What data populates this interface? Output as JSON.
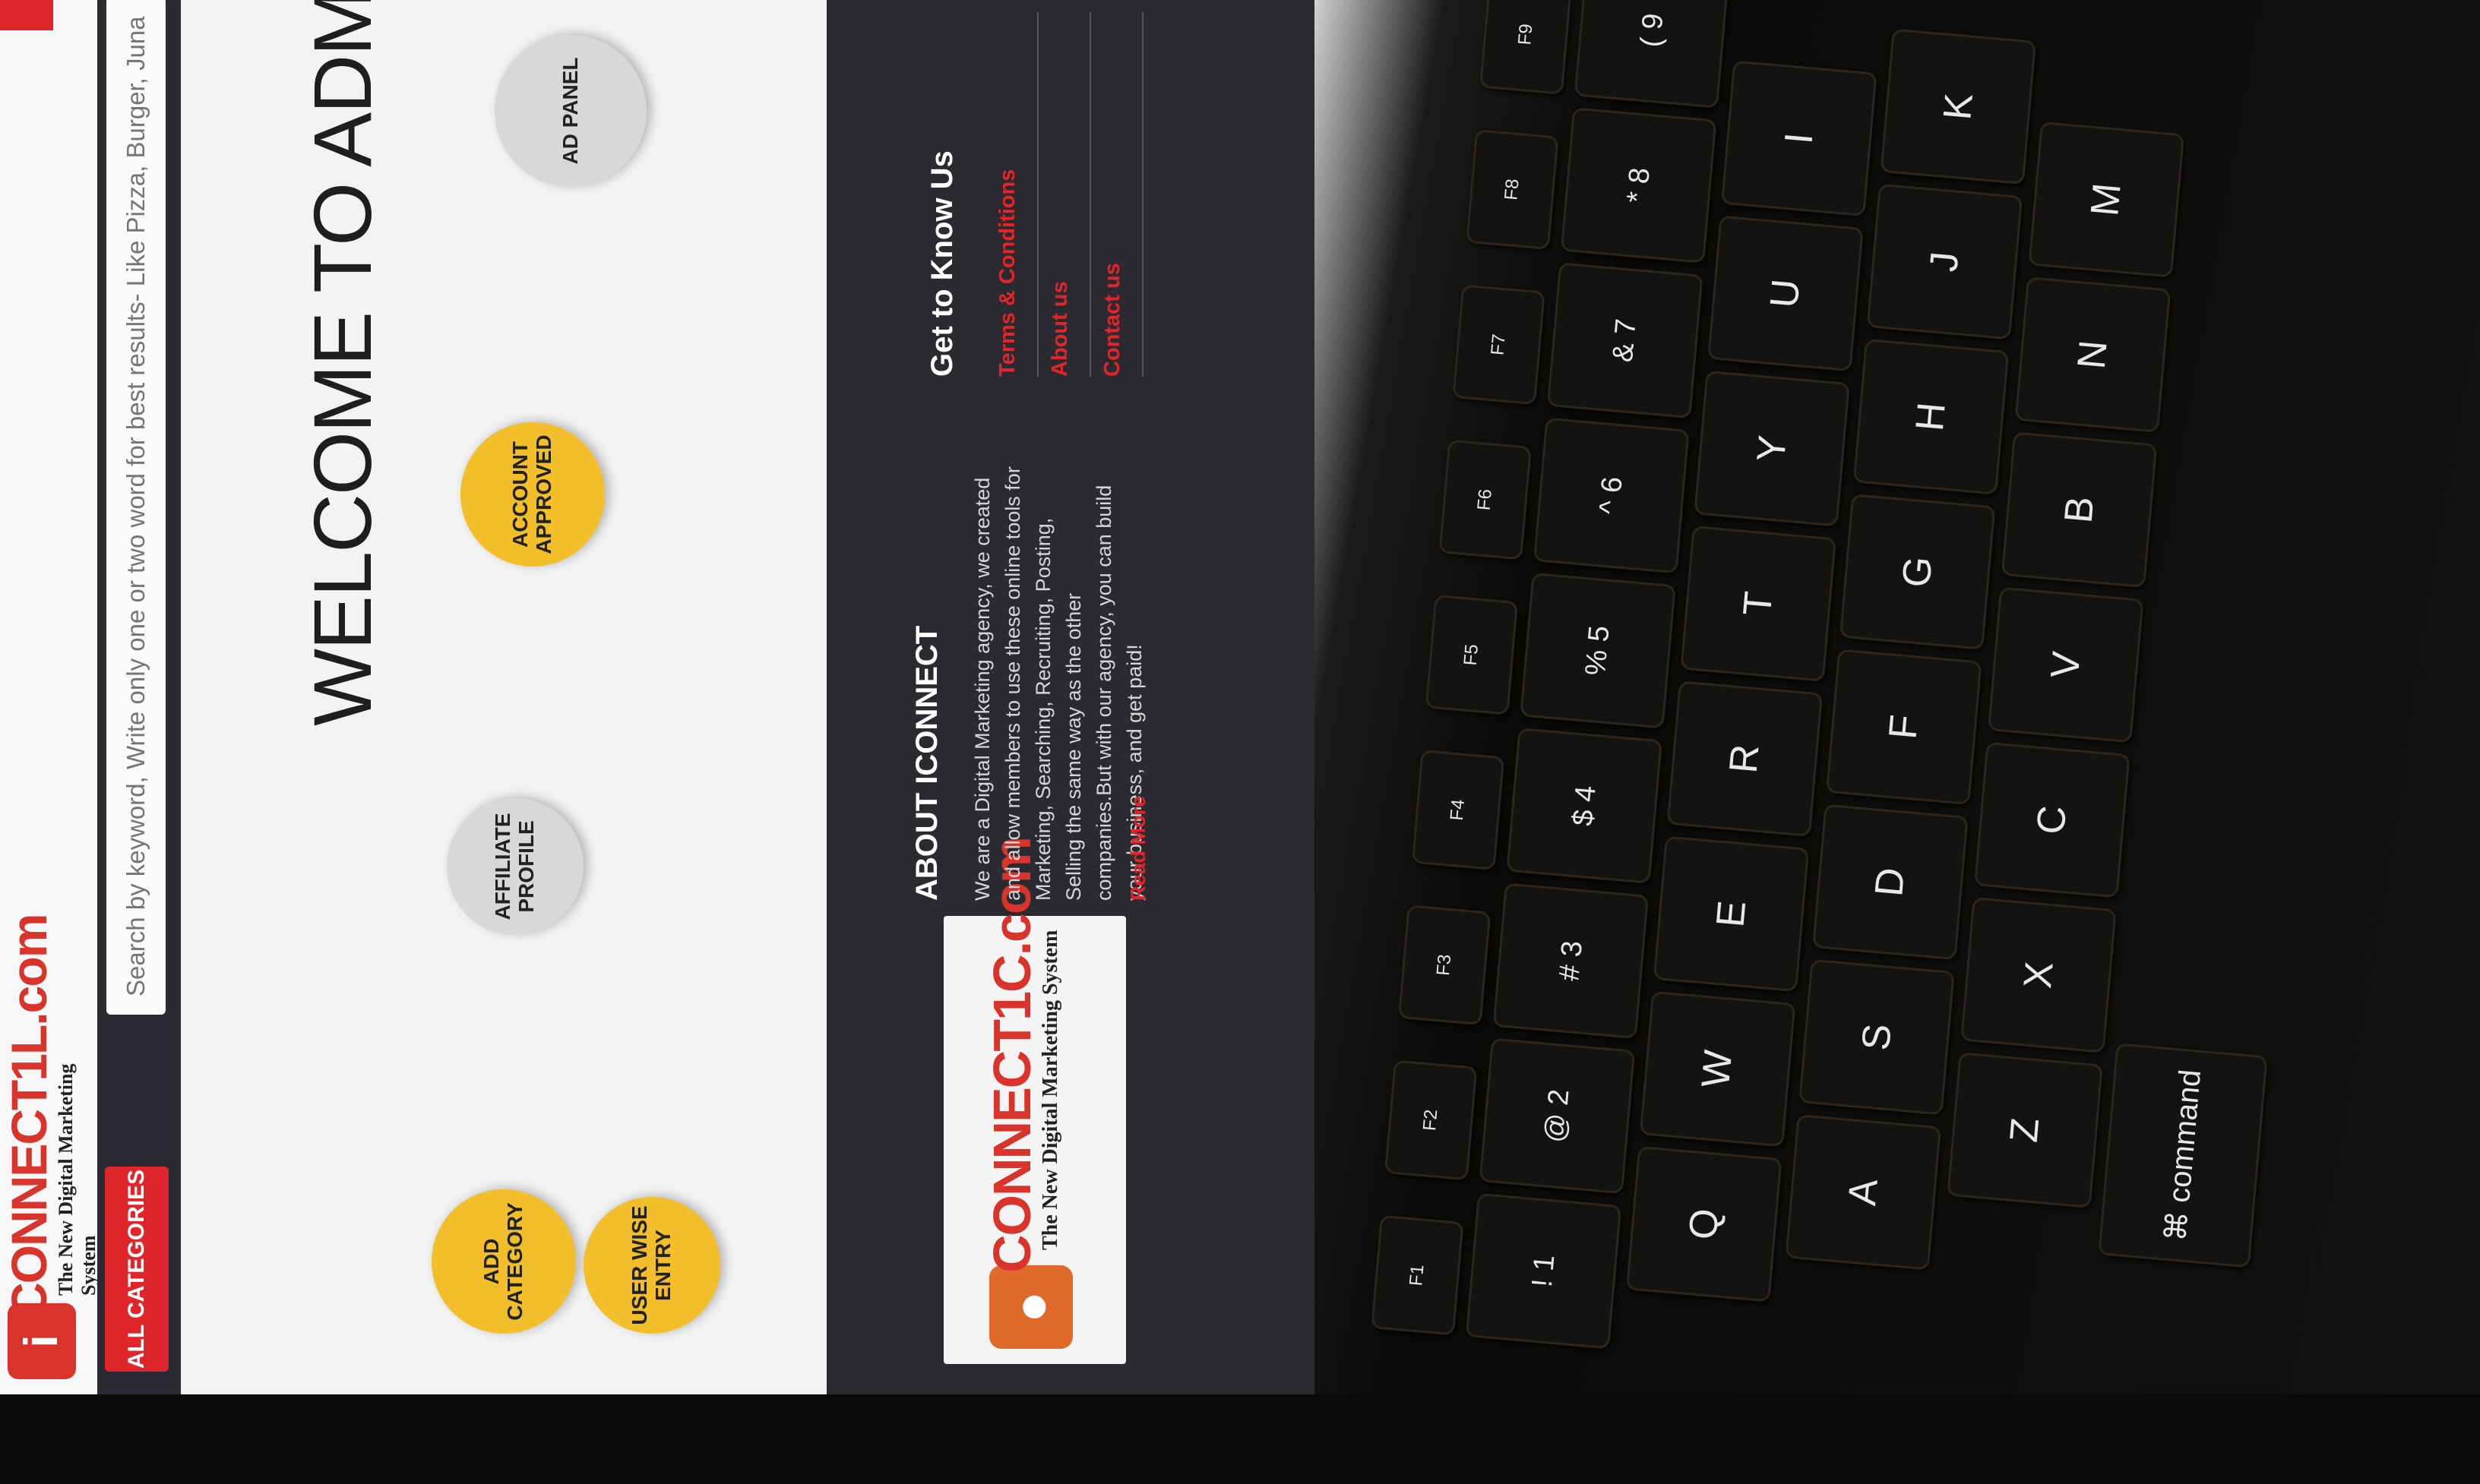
{
  "site": {
    "logo": {
      "mark": "i",
      "word": "CONNECT1L.com",
      "tagline": "The New Digital Marketing System"
    },
    "all_categories_label": "ALL CATEGORIES ▾",
    "search_placeholder": "Search by keyword, Write only one or two word for best results- Like Pizza, Burger, Junaid Jai",
    "welcome_heading": "WELCOME TO ADMIN PA",
    "circles": [
      {
        "label": "ADD CATEGORY",
        "color": "#f2bf2a"
      },
      {
        "label": "USER WISE ENTRY",
        "color": "#f2bf2a"
      },
      {
        "label": "AFFILIATE PROFILE",
        "color": "#d6d8da"
      },
      {
        "label": "ACCOUNT APPROVED",
        "color": "#f2bf2a"
      },
      {
        "label": "AD PANEL",
        "color": "#d6d8da"
      }
    ],
    "footer": {
      "logo_word": "CONNECT1C.com",
      "logo_tagline": "The New Digital Marketing System",
      "about_title": "ABOUT ICONNECT",
      "about_text": "We are a Digital Marketing agency, we created and allow members to use these online tools for Marketing, Searching, Recruiting, Posting, Selling the same way as the other companies.But with our agency, you can build your business, and get paid!",
      "read_more": "Read More",
      "get_to_know_title": "Get to Know Us",
      "links": [
        "Terms & Conditions",
        "About us",
        "Contact us"
      ]
    },
    "colors": {
      "accent_red": "#e0262a",
      "footer_bg": "#2a2a30",
      "yellow": "#f2bf2a",
      "gray": "#d6d8da"
    }
  },
  "keyboard": {
    "rows": [
      [
        "F1",
        "F2",
        "F3",
        "F4",
        "F5",
        "F6",
        "F7",
        "F8",
        "F9"
      ],
      [
        "! 1",
        "@ 2",
        "# 3",
        "$ 4",
        "% 5",
        "^ 6",
        "& 7",
        "* 8",
        "( 9"
      ],
      [
        "Q",
        "W",
        "E",
        "R",
        "T",
        "Y",
        "U",
        "I"
      ],
      [
        "A",
        "S",
        "D",
        "F",
        "G",
        "H",
        "J",
        "K"
      ],
      [
        "Z",
        "X",
        "C",
        "V",
        "B",
        "N",
        "M"
      ],
      [
        "⌘ command"
      ]
    ]
  }
}
